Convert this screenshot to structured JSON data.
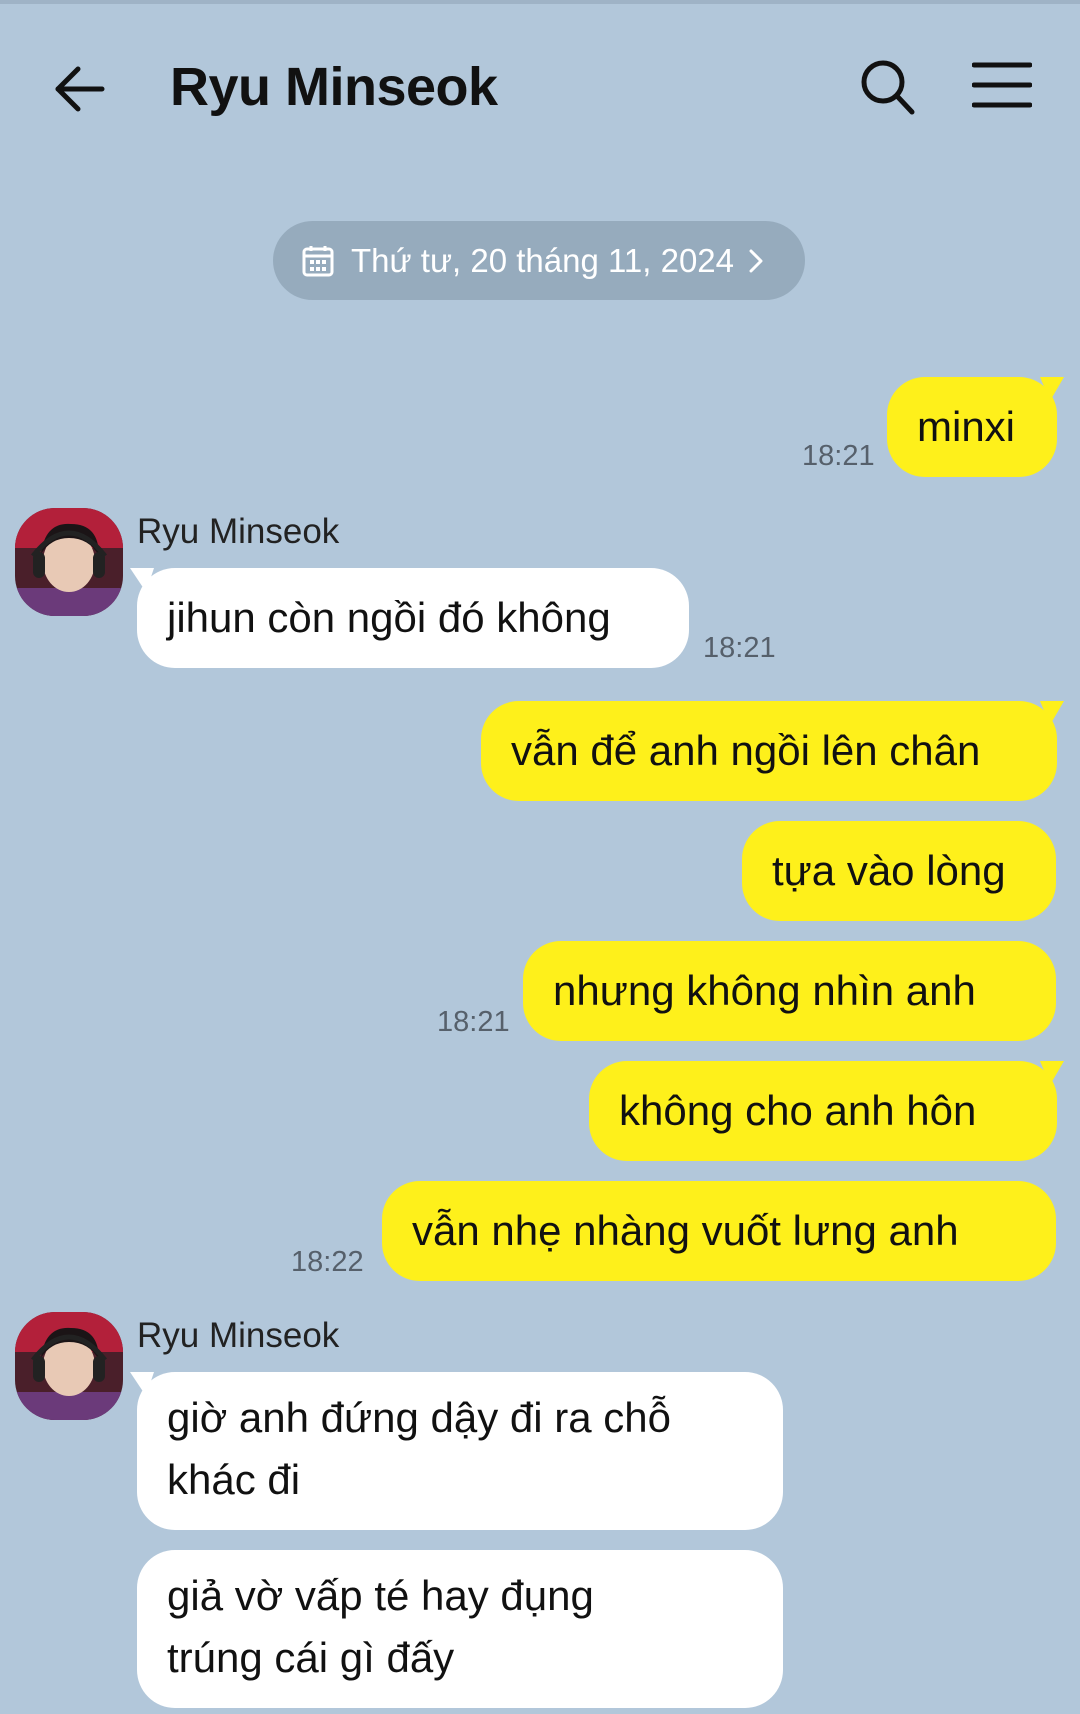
{
  "header": {
    "title": "Ryu Minseok",
    "back_icon": "arrow-left-icon",
    "search_icon": "search-icon",
    "menu_icon": "hamburger-menu-icon"
  },
  "date_divider": {
    "text": "Thứ tư, 20 tháng 11, 2024",
    "icon": "calendar-icon"
  },
  "colors": {
    "background": "#b2c7da",
    "my_bubble": "#fef01b",
    "their_bubble": "#ffffff",
    "date_pill": "#96abbd"
  },
  "messages": [
    {
      "from": "me",
      "text": "minxi",
      "time": "18:21"
    },
    {
      "from": "them",
      "sender": "Ryu Minseok",
      "text": "jihun còn ngồi đó không",
      "time": "18:21"
    },
    {
      "from": "me",
      "text": "vẫn để anh ngồi lên chân"
    },
    {
      "from": "me",
      "text": "tựa vào lòng"
    },
    {
      "from": "me",
      "text": "nhưng không nhìn anh",
      "time": "18:21"
    },
    {
      "from": "me",
      "text": "không cho anh hôn"
    },
    {
      "from": "me",
      "text": "vẫn nhẹ nhàng vuốt lưng anh",
      "time": "18:22"
    },
    {
      "from": "them",
      "sender": "Ryu Minseok",
      "lines": [
        "giờ anh đứng dậy đi ra chỗ",
        "khác đi"
      ]
    },
    {
      "from": "them",
      "lines": [
        "giả vờ vấp té hay đụng",
        "trúng cái gì đấy"
      ]
    }
  ]
}
